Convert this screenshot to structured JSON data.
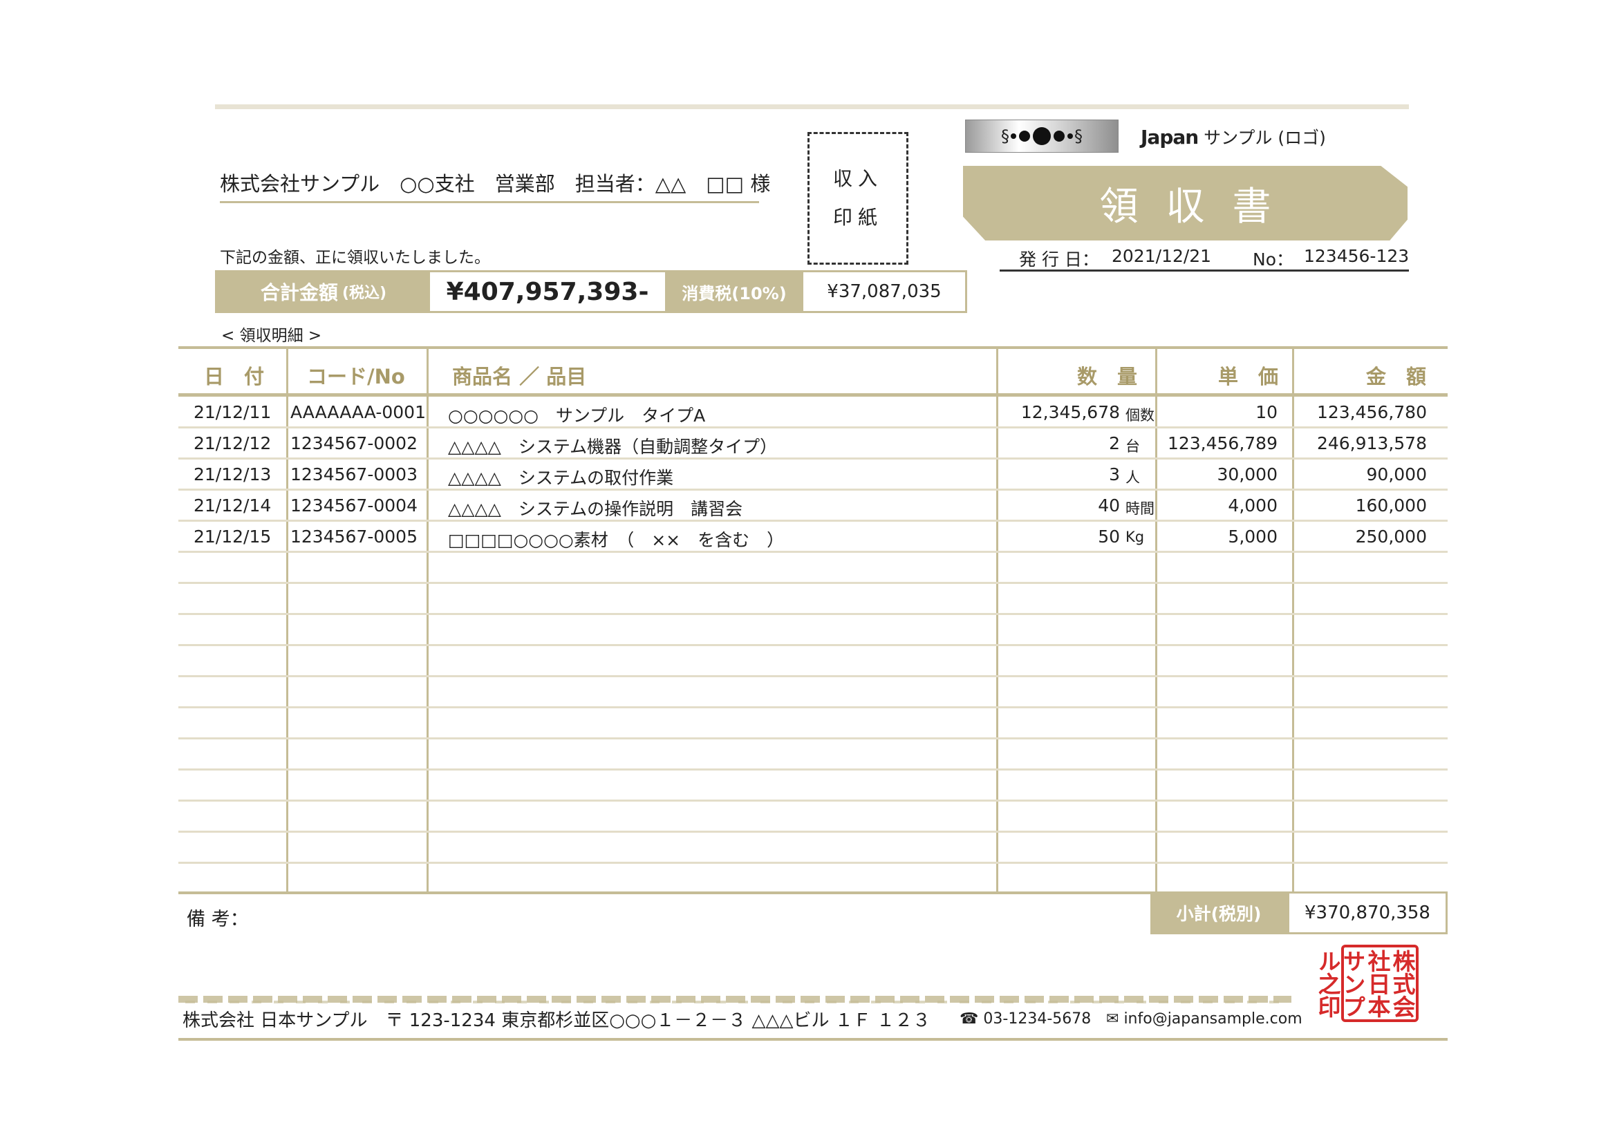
{
  "recipient": "株式会社サンプル　○○支社　営業部　担当者：△△　□□ 様",
  "stamp": {
    "line1": "収入",
    "line2": "印紙"
  },
  "logo": {
    "mark_left": "§",
    "mark_right": "§",
    "brand": "Japan",
    "text": "サンプル (ロゴ)"
  },
  "title": "領収書",
  "issue": {
    "date_label": "発 行 日：",
    "date": "2021/12/21",
    "no_label": "No：",
    "no": "123456-123"
  },
  "received_text": "下記の金額、正に領収いたしました。",
  "totals": {
    "label": "合計金額",
    "label_note": "(税込)",
    "amount": "¥407,957,393-",
    "tax_label": "消費税(10%)",
    "tax_amount": "¥37,087,035"
  },
  "details_label": "< 領収明細 >",
  "table": {
    "headers": {
      "date": "日　付",
      "code": "コード/No",
      "item": "商品名 ／ 品目",
      "qty": "数　量",
      "unit_price": "単　価",
      "amount": "金　額"
    },
    "rows": [
      {
        "date": "21/12/11",
        "code": "AAAAAAA-0001",
        "item": "○○○○○○　サンプル　タイプA",
        "qty": "12,345,678",
        "unit": "個数",
        "unit_price": "10",
        "amount": "123,456,780"
      },
      {
        "date": "21/12/12",
        "code": "1234567-0002",
        "item": "△△△△　システム機器（自動調整タイプ）",
        "qty": "2",
        "unit": "台",
        "unit_price": "123,456,789",
        "amount": "246,913,578"
      },
      {
        "date": "21/12/13",
        "code": "1234567-0003",
        "item": "△△△△　システムの取付作業",
        "qty": "3",
        "unit": "人",
        "unit_price": "30,000",
        "amount": "90,000"
      },
      {
        "date": "21/12/14",
        "code": "1234567-0004",
        "item": "△△△△　システムの操作説明　講習会",
        "qty": "40",
        "unit": "時間",
        "unit_price": "4,000",
        "amount": "160,000"
      },
      {
        "date": "21/12/15",
        "code": "1234567-0005",
        "item": "□□□□○○○○素材　（　××　を含む　）",
        "qty": "50",
        "unit": "Kg",
        "unit_price": "5,000",
        "amount": "250,000"
      }
    ]
  },
  "remarks_label": "備 考：",
  "subtotal": {
    "label": "小計(税別)",
    "amount": "¥370,870,358"
  },
  "footer": {
    "address": "株式会社 日本サンプル　〒 123-1234 東京都杉並区○○○１－２－３ △△△ビル １Ｆ １２３",
    "tel": "03-1234-5678",
    "email": "info@japansample.com"
  },
  "seal_text": "株式会社日本サンプル之印"
}
